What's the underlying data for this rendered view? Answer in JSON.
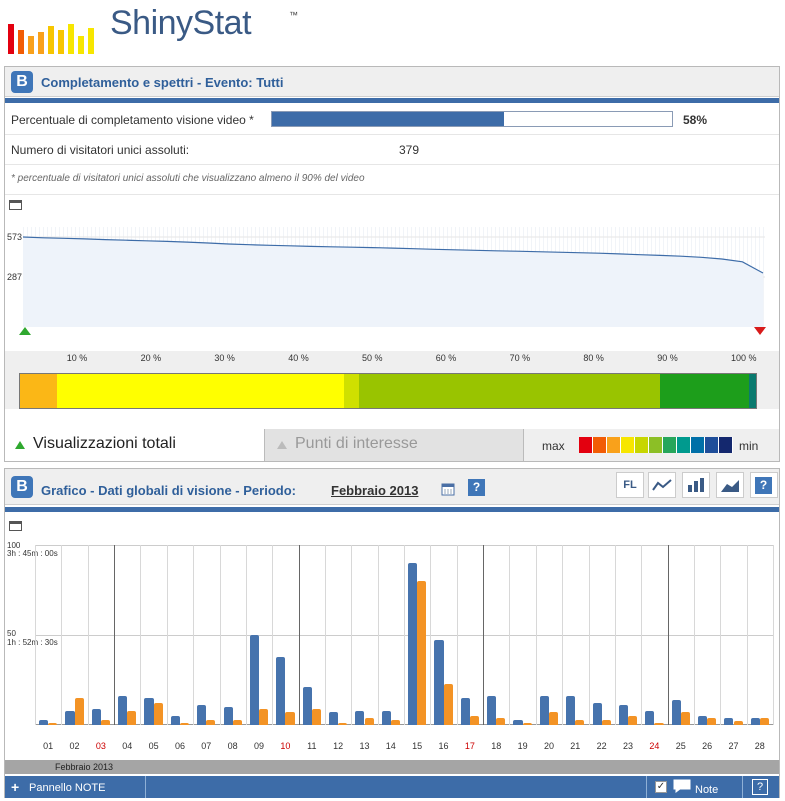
{
  "logo": {
    "text": "ShinyStat",
    "tm": "™"
  },
  "panel1": {
    "title": "Completamento e spettri - Evento: Tutti",
    "completion_label": "Percentuale di completamento visione video *",
    "completion_value": "58%",
    "completion_fraction": 0.58,
    "visitors_label": "Numero di visitatori unici assoluti:",
    "visitors_value": "379",
    "footnote": "* percentuale di visitatori unici assoluti che visualizzano almeno il 90% del video",
    "y_top": "573",
    "y_mid": "287",
    "x_ticks": [
      "10 %",
      "20 %",
      "30 %",
      "40 %",
      "50 %",
      "60 %",
      "70 %",
      "80 %",
      "90 %",
      "100 %"
    ],
    "tab_active": "Visualizzazioni totali",
    "tab_inactive": "Punti di interesse",
    "legend_max": "max",
    "legend_min": "min",
    "legend_colors": [
      "#e3000f",
      "#f25c05",
      "#f9a11b",
      "#f7e600",
      "#c7d600",
      "#8cbf26",
      "#26a65b",
      "#009a8e",
      "#0070a8",
      "#1f4e9a",
      "#14286e"
    ]
  },
  "panel2": {
    "title_prefix": "Grafico - Dati globali di visione - Periodo:",
    "period": "Febbraio 2013",
    "toolbar_fl": "FL",
    "y_top_a": "100",
    "y_top_b": "3h : 45m : 00s",
    "y_mid_a": "50",
    "y_mid_b": "1h : 52m : 30s",
    "month_label": "Febbraio 2013",
    "footer_label": "Pannello NOTE",
    "note_label": "Note"
  },
  "chart_data": {
    "type": "bar",
    "categories": [
      "01",
      "02",
      "03",
      "04",
      "05",
      "06",
      "07",
      "08",
      "09",
      "10",
      "11",
      "12",
      "13",
      "14",
      "15",
      "16",
      "17",
      "18",
      "19",
      "20",
      "21",
      "22",
      "23",
      "24",
      "25",
      "26",
      "27",
      "28"
    ],
    "weekend_days": [
      "03",
      "10",
      "17",
      "24"
    ],
    "series": [
      {
        "values": [
          3,
          8,
          9,
          16,
          15,
          5,
          11,
          10,
          50,
          38,
          21,
          7,
          8,
          8,
          90,
          47,
          15,
          16,
          3,
          16,
          16,
          12,
          11,
          8,
          14,
          5,
          4,
          4
        ],
        "color": "#4673ad"
      },
      {
        "values": [
          1,
          15,
          3,
          8,
          12,
          1,
          3,
          3,
          9,
          7,
          9,
          1,
          4,
          3,
          80,
          23,
          5,
          4,
          1,
          7,
          3,
          3,
          5,
          1,
          7,
          4,
          2,
          4
        ],
        "color": "#f39325"
      }
    ],
    "ylim": [
      0,
      100
    ]
  },
  "spectrum": [
    {
      "from": 0,
      "to": 5,
      "color": "#fbb716"
    },
    {
      "from": 5,
      "to": 44,
      "color": "#ffff00"
    },
    {
      "from": 44,
      "to": 46,
      "color": "#cfe000"
    },
    {
      "from": 46,
      "to": 87,
      "color": "#99c400"
    },
    {
      "from": 87,
      "to": 99,
      "color": "#1d9e1b"
    },
    {
      "from": 99,
      "to": 100,
      "color": "#0a7a6f"
    }
  ],
  "curve": [
    100,
    99,
    98.4,
    97.6,
    96.8,
    96,
    95.3,
    94.5,
    93.6,
    92.5,
    91.2,
    90.4,
    89.6,
    89,
    88.3,
    87.8,
    87.3,
    86.7,
    86.1,
    85.4,
    84.6,
    84,
    83.4,
    82.8,
    82.2,
    81.6,
    81,
    80.4,
    79.7,
    78.9,
    77.9,
    77,
    76,
    74.6,
    72.5,
    69,
    55
  ]
}
